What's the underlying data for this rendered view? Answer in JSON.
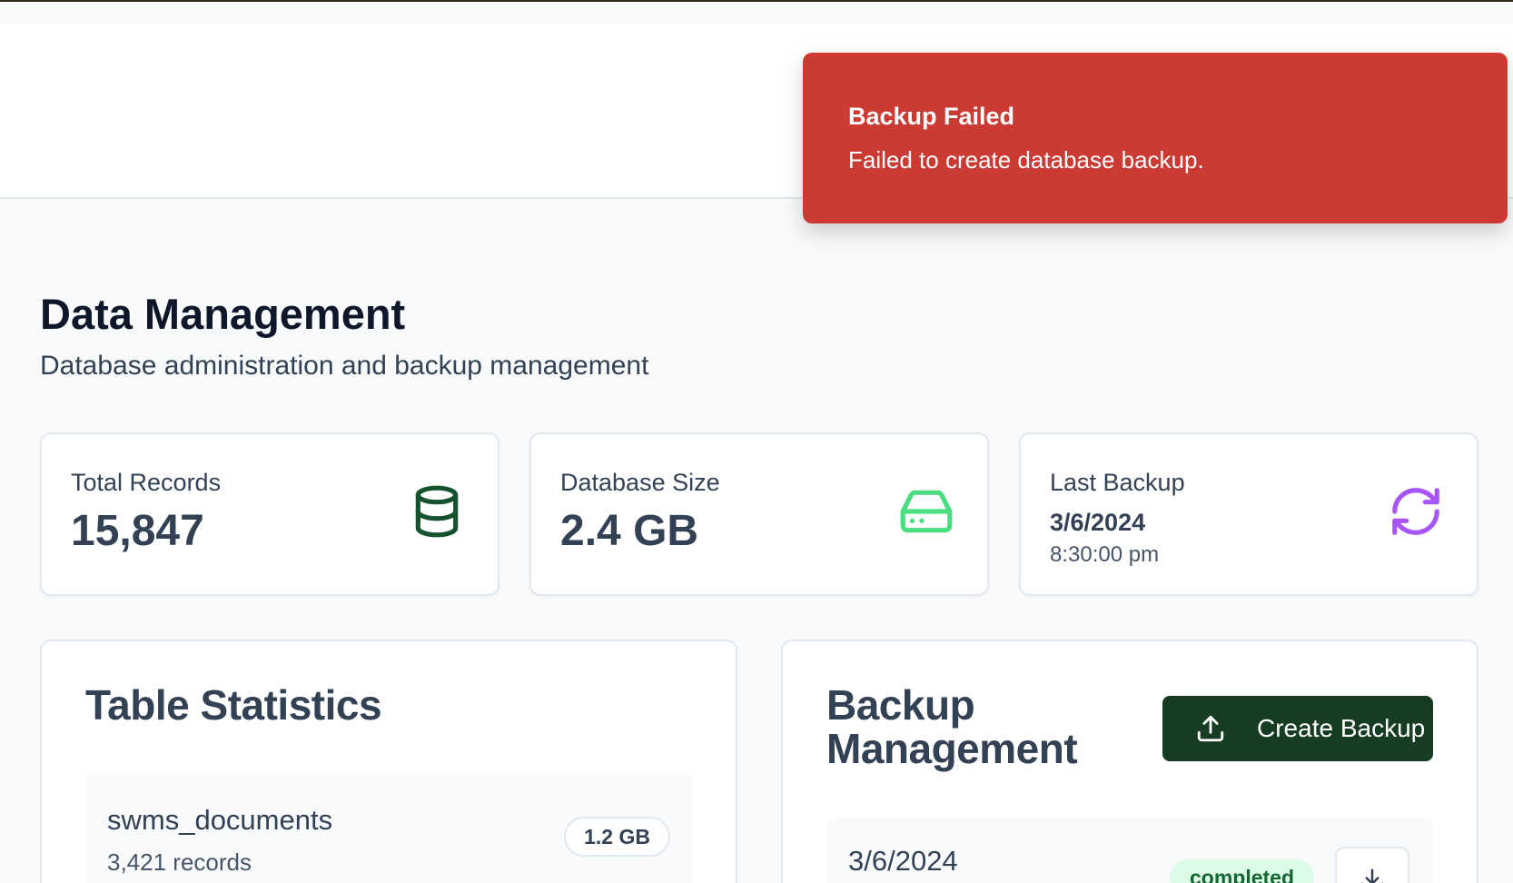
{
  "toast": {
    "title": "Backup Failed",
    "message": "Failed to create database backup."
  },
  "page": {
    "title": "Data Management",
    "subtitle": "Database administration and backup management"
  },
  "stats": {
    "total_records": {
      "label": "Total Records",
      "value": "15,847",
      "icon": "database-icon",
      "color": "#14532d"
    },
    "database_size": {
      "label": "Database Size",
      "value": "2.4 GB",
      "icon": "hard-drive-icon",
      "color": "#4ade80"
    },
    "last_backup": {
      "label": "Last Backup",
      "date": "3/6/2024",
      "time": "8:30:00 pm",
      "icon": "refresh-icon",
      "color": "#a855f7"
    }
  },
  "table_statistics": {
    "title": "Table Statistics",
    "rows": [
      {
        "name": "swms_documents",
        "records": "3,421 records",
        "size": "1.2 GB"
      }
    ]
  },
  "backup_management": {
    "title": "Backup Management",
    "create_label": "Create Backup",
    "rows": [
      {
        "date": "3/6/2024",
        "status": "completed"
      }
    ]
  },
  "colors": {
    "toast_bg": "#cb3a33",
    "primary_button": "#163d22",
    "status_completed_bg": "#dcfce7",
    "status_completed_text": "#166534"
  }
}
